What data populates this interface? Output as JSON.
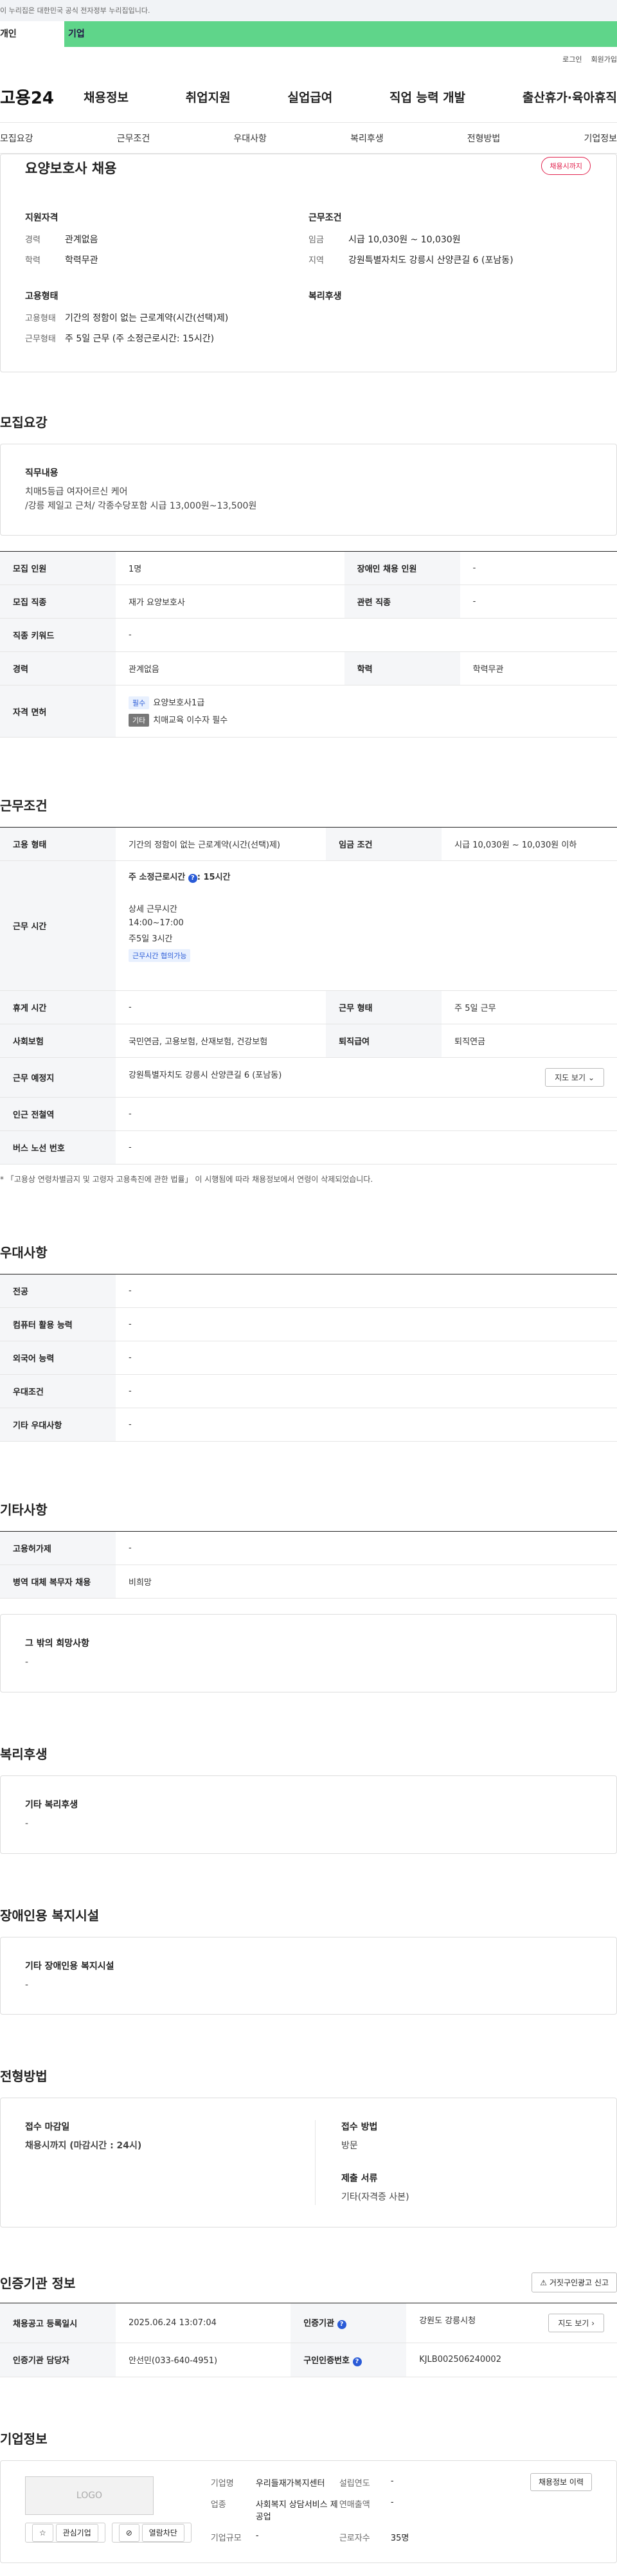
{
  "gov_banner": "이 누리집은 대한민국 공식 전자정부 누리집입니다.",
  "user_tabs": [
    "개인",
    "기업"
  ],
  "util_links": [
    "로그인",
    "회원가입"
  ],
  "logo": "고용24",
  "gnb": [
    "채용정보",
    "취업지원",
    "실업급여",
    "직업 능력 개발",
    "출산휴가·육아휴직"
  ],
  "anchor_nav": [
    "모집요강",
    "근무조건",
    "우대사항",
    "복리후생",
    "전형방법",
    "기업정보"
  ],
  "summary": {
    "title": "요양보호사 채용",
    "badge": "채용시까지",
    "qual_title": "지원자격",
    "qual": [
      {
        "k": "경력",
        "v": "관계없음"
      },
      {
        "k": "학력",
        "v": "학력무관"
      }
    ],
    "cond_title": "근무조건",
    "cond": [
      {
        "k": "임금",
        "v": "시급 10,030원 ~ 10,030원"
      },
      {
        "k": "지역",
        "v": "강원특별자치도 강릉시 산양큰길 6 (포남동)"
      }
    ],
    "emp_title": "고용형태",
    "emp": [
      {
        "k": "고용형태",
        "v": "기간의 정함이 없는 근로계약(시간(선택)제)"
      },
      {
        "k": "근무형태",
        "v": "주 5일 근무 (주 소정근로시간: 15시간)"
      }
    ],
    "welfare_title": "복리후생"
  },
  "recruit": {
    "title": "모집요강",
    "duty_label": "직무내용",
    "duty_line1": "치매5등급 여자어르신 케어",
    "duty_line2": "/강릉 제일고 근처/ 각종수당포함 시급 13,000원~13,500원",
    "rows": {
      "count_k": "모집 인원",
      "count_v": "1명",
      "disabled_k": "장애인 채용 인원",
      "disabled_v": "-",
      "job_k": "모집 직종",
      "job_v": "재가 요양보호사",
      "rel_k": "관련 직종",
      "rel_v": "-",
      "kw_k": "직종 키워드",
      "kw_v": "-",
      "career_k": "경력",
      "career_v": "관계없음",
      "edu_k": "학력",
      "edu_v": "학력무관",
      "lic_k": "자격 면허",
      "lic_tag1": "필수",
      "lic_v1": "요양보호사1급",
      "lic_tag2": "기타",
      "lic_v2": "치매교육 이수자 필수"
    }
  },
  "work": {
    "title": "근무조건",
    "type_k": "고용 형태",
    "type_v": "기간의 정함이 없는 근로계약(시간(선택)제)",
    "wage_k": "임금 조건",
    "wage_v": "시급 10,030원 ~ 10,030원 이하",
    "time_k": "근무 시간",
    "time_week": "주 소정근로시간",
    "time_hours": ": 15시간",
    "time_detail": "상세 근무시간",
    "time_range": "14:00~17:00",
    "time_days": "주5일 3시간",
    "time_tag": "근무시간 협의가능",
    "rest_k": "휴게 시간",
    "rest_v": "-",
    "form_k": "근무 형태",
    "form_v": "주 5일 근무",
    "ins_k": "사회보험",
    "ins_v": "국민연금, 고용보험, 산재보험, 건강보험",
    "sev_k": "퇴직급여",
    "sev_v": "퇴직연금",
    "addr_k": "근무 예정지",
    "addr_v": "강원특별자치도 강릉시 산양큰길 6 (포남동)",
    "map_btn": "지도 보기",
    "sub_k": "인근 전철역",
    "sub_v": "-",
    "bus_k": "버스 노선 번호",
    "bus_v": "-",
    "note": "* 「고용상 연령차별금지 및 고령자 고용촉진에 관한 법률」 이 시행됨에 따라 채용정보에서 연령이 삭제되었습니다."
  },
  "pref": {
    "title": "우대사항",
    "rows": [
      {
        "k": "전공",
        "v": "-"
      },
      {
        "k": "컴퓨터 활용 능력",
        "v": "-"
      },
      {
        "k": "외국어 능력",
        "v": "-"
      },
      {
        "k": "우대조건",
        "v": "-"
      },
      {
        "k": "기타 우대사항",
        "v": "-"
      }
    ]
  },
  "other": {
    "title": "기타사항",
    "rows": [
      {
        "k": "고용허가제",
        "v": "-"
      },
      {
        "k": "병역 대체 복무자 채용",
        "v": "비희망"
      }
    ],
    "box_label": "그 밖의 희망사항",
    "box_v": "-"
  },
  "welfare": {
    "title": "복리후생",
    "label": "기타 복리후생",
    "v": "-"
  },
  "disab": {
    "title": "장애인용 복지시설",
    "label": "기타 장애인용 복지시설",
    "v": "-"
  },
  "select": {
    "title": "전형방법",
    "deadline_k": "접수 마감일",
    "deadline_v": "채용시까지 (마감시간 : 24시)",
    "method_k": "접수 방법",
    "method_v": "방문",
    "docs_k": "제출 서류",
    "docs_v": "기타(자격증 사본)"
  },
  "cert": {
    "title": "인증기관 정보",
    "report_btn": "거짓구인광고 신고",
    "reg_k": "채용공고 등록일시",
    "reg_v": "2025.06.24 13:07:04",
    "org_k": "인증기관",
    "org_v": "강원도 강릉시청",
    "map_btn": "지도 보기",
    "mgr_k": "인증기관 담당자",
    "mgr_v": "안선민(033-640-4951)",
    "num_k": "구인인증번호",
    "num_v": "KJLB002506240002"
  },
  "company": {
    "title": "기업정보",
    "logo_text": "LOGO",
    "fav_btn": "관심기업",
    "block_btn": "열람차단",
    "name_k": "기업명",
    "name_v": "우리들재가복지센터",
    "year_k": "설립연도",
    "year_v": "-",
    "biz_k": "업종",
    "biz_v": "사회복지 상담서비스 제공업",
    "sales_k": "연매출액",
    "sales_v": "-",
    "emp_k": "근로자수",
    "emp_v": "35명",
    "size_k": "기업규모",
    "size_v": "-",
    "history_btn": "채용정보 이력"
  }
}
